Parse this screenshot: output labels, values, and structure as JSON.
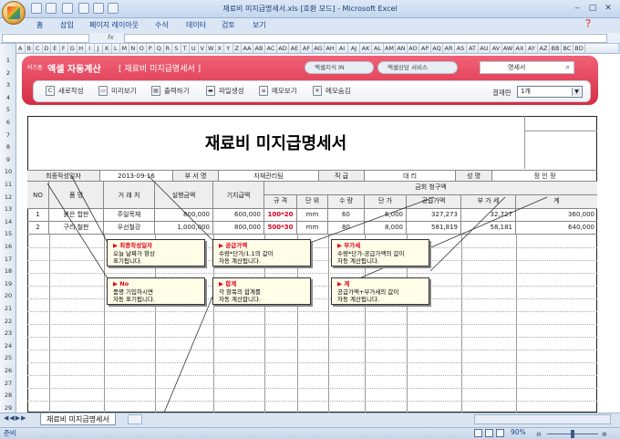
{
  "window": {
    "title": "재료비 미지급명세서.xls [호환 모드] - Microsoft Excel"
  },
  "ribbon_tabs": [
    "홈",
    "삽입",
    "페이지 레이아웃",
    "수식",
    "데이터",
    "검토",
    "보기"
  ],
  "formula_bar": {
    "function_symbol": "fx"
  },
  "columns": [
    "A",
    "B",
    "C",
    "D",
    "E",
    "F",
    "G",
    "H",
    "I",
    "J",
    "K",
    "L",
    "M",
    "N",
    "O",
    "P",
    "Q",
    "R",
    "S",
    "T",
    "U",
    "V",
    "W",
    "X",
    "Y",
    "Z",
    "AA",
    "AB",
    "AC",
    "AD",
    "AE",
    "AF",
    "AG",
    "AH",
    "AI",
    "AJ",
    "AK",
    "AL",
    "AM",
    "AN",
    "AO",
    "AP",
    "AQ",
    "AR",
    "AS",
    "AT",
    "AU",
    "AV",
    "AW",
    "AX",
    "AY",
    "AZ",
    "BB",
    "BC",
    "BD"
  ],
  "rows": [
    "1",
    "2",
    "3",
    "4",
    "5",
    "6",
    "7",
    "8",
    "9",
    "10",
    "11",
    "12",
    "13",
    "14",
    "15",
    "16",
    "17",
    "18",
    "19",
    "20",
    "21",
    "22",
    "23",
    "24",
    "25",
    "26",
    "27",
    "28",
    "29"
  ],
  "banner": {
    "brand_small": "비즈폼",
    "brand": "엑셀 자동계산",
    "system_name": "[ 재료비 미지급명세서 ]",
    "link1": "엑셀지식 IN",
    "link2": "엑셀상담 서비스",
    "search_value": "명세서"
  },
  "toolbar": {
    "new": "새로작성",
    "preview": "미리보기",
    "print": "출력하기",
    "file": "파일생성",
    "memo_view": "메모보기",
    "memo_hide": "메모숨김",
    "approval_label": "결재란",
    "approval_value": "1개"
  },
  "form": {
    "title": "재료비 미지급명세서",
    "info": {
      "date_label": "최종작성일자",
      "date_value": "2013-09-16",
      "dept_label": "부 서 명",
      "dept_value": "자재관리팀",
      "rank_label": "직 급",
      "rank_value": "대 리",
      "name_label": "성 명",
      "name_value": "정 인 정"
    },
    "headers": {
      "no": "NO",
      "item": "품 명",
      "vendor": "거 래 처",
      "exec": "실행금액",
      "paid": "기지급액",
      "claim": "금회 청구액",
      "spec": "규 격",
      "unit": "단 위",
      "qty": "수 량",
      "price": "단 가",
      "supply": "공급가액",
      "vat": "부 가 세",
      "total": "계"
    },
    "rows": [
      {
        "no": "1",
        "item": "붉은 합판",
        "vendor": "주일목재",
        "exec": "800,000",
        "paid": "600,000",
        "spec": "100*20",
        "unit": "mm",
        "qty": "60",
        "price": "6,000",
        "supply": "327,273",
        "vat": "32,727",
        "total": "360,000"
      },
      {
        "no": "2",
        "item": "구리 철판",
        "vendor": "우선철강",
        "exec": "1,000,000",
        "paid": "800,000",
        "spec": "500*30",
        "unit": "mm",
        "qty": "80",
        "price": "8,000",
        "supply": "581,819",
        "vat": "58,181",
        "total": "640,000"
      }
    ]
  },
  "callouts": [
    {
      "title": "최종작성일자",
      "body1": "오늘 날짜가 항상",
      "body2": "표기됩니다."
    },
    {
      "title": "공급가액",
      "body1": "수량*단가/1.1의 값이",
      "body2": "자동 계산됩니다."
    },
    {
      "title": "부가세",
      "body1": "수량*단가-공급가액의 값이",
      "body2": "자동 계산됩니다."
    },
    {
      "title": "No",
      "body1": "품명 기입하시면",
      "body2": "자동 표기됩니다."
    },
    {
      "title": "합계",
      "body1": "각 항목의 합계를",
      "body2": "자동 계산합니다."
    },
    {
      "title": "계",
      "body1": "공급가액+부가세의 값이",
      "body2": "자동 계산됩니다."
    }
  ],
  "sheet_tab": "재료비 미지급명세서",
  "status": "준비",
  "zoom": "90%"
}
